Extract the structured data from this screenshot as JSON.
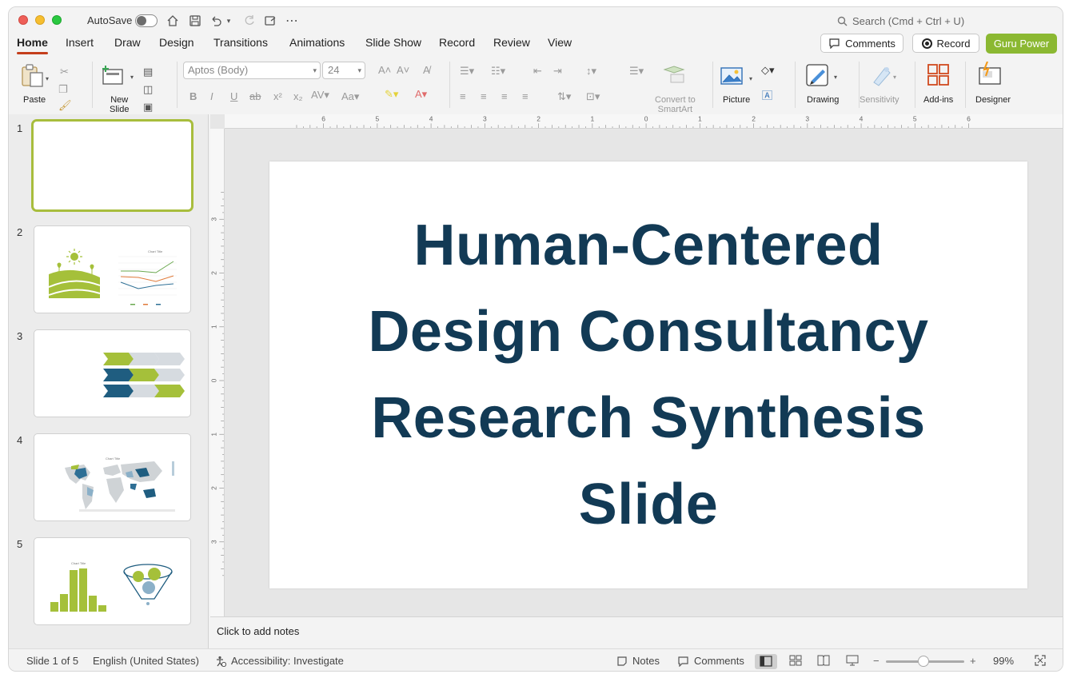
{
  "titlebar": {
    "autosave_label": "AutoSave",
    "search_placeholder": "Search (Cmd + Ctrl + U)"
  },
  "tabs": [
    "Home",
    "Insert",
    "Draw",
    "Design",
    "Transitions",
    "Animations",
    "Slide Show",
    "Record",
    "Review",
    "View"
  ],
  "active_tab": "Home",
  "header_buttons": {
    "comments": "Comments",
    "record": "Record",
    "guru": "Guru Power"
  },
  "ribbon": {
    "paste": "Paste",
    "new_slide_line1": "New",
    "new_slide_line2": "Slide",
    "font_name": "Aptos (Body)",
    "font_size": "24",
    "convert_line1": "Convert to",
    "convert_line2": "SmartArt",
    "picture": "Picture",
    "drawing": "Drawing",
    "sensitivity": "Sensitivity",
    "addins": "Add-ins",
    "designer": "Designer"
  },
  "ruler": {
    "h_labels": [
      "6",
      "5",
      "4",
      "3",
      "2",
      "1",
      "0",
      "1",
      "2",
      "3",
      "4",
      "5",
      "6"
    ],
    "v_labels": [
      "3",
      "2",
      "1",
      "0",
      "1",
      "2",
      "3"
    ]
  },
  "thumbnails": [
    {
      "number": "1"
    },
    {
      "number": "2",
      "chart_title": "Chart Title"
    },
    {
      "number": "3"
    },
    {
      "number": "4",
      "chart_title": "Chart Title"
    },
    {
      "number": "5",
      "chart_title": "Chart Title"
    }
  ],
  "slide": {
    "title": "Human-Centered Design Consultancy Research Synthesis Slide"
  },
  "notes_placeholder": "Click to add notes",
  "statusbar": {
    "slide_position": "Slide 1 of 5",
    "language": "English (United States)",
    "accessibility": "Accessibility: Investigate",
    "notes": "Notes",
    "comments": "Comments",
    "zoom": "99%"
  },
  "colors": {
    "title_text": "#123a55",
    "accent_green": "#a8bd3d",
    "guru_button": "#8bb832",
    "dark_teal": "#1f5d80"
  }
}
